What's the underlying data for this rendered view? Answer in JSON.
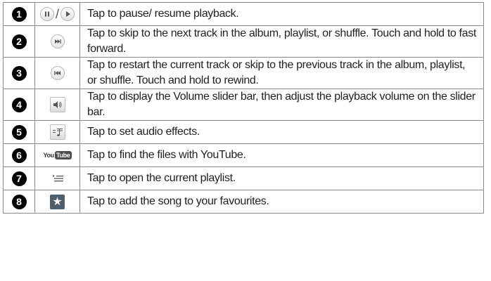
{
  "rows": [
    {
      "number": "1",
      "icon": "pause-play-icon",
      "slash": "/",
      "description": "Tap to pause/ resume playback."
    },
    {
      "number": "2",
      "icon": "next-track-icon",
      "description": "Tap to skip to the next track in the album, playlist, or shuffle. Touch and hold to fast forward."
    },
    {
      "number": "3",
      "icon": "previous-track-icon",
      "description": "Tap to restart the current track or skip to the previous track in the album, playlist, or shuffle. Touch and hold to rewind."
    },
    {
      "number": "4",
      "icon": "volume-icon",
      "description": "Tap to display the Volume slider bar, then adjust the playback volume on the slider bar."
    },
    {
      "number": "5",
      "icon": "audio-effects-icon",
      "description": "Tap to set audio effects."
    },
    {
      "number": "6",
      "icon": "youtube-icon",
      "icon_text_1": "You",
      "icon_text_2": "Tube",
      "description": "Tap to find the files with YouTube."
    },
    {
      "number": "7",
      "icon": "playlist-icon",
      "description": "Tap to open the current playlist."
    },
    {
      "number": "8",
      "icon": "favourite-star-icon",
      "description": "Tap to add the song to your favourites."
    }
  ],
  "colors": {
    "badge": "#000000",
    "border": "#8a8a8a",
    "text": "#231f20",
    "star_bg": "#4f5e6b"
  }
}
